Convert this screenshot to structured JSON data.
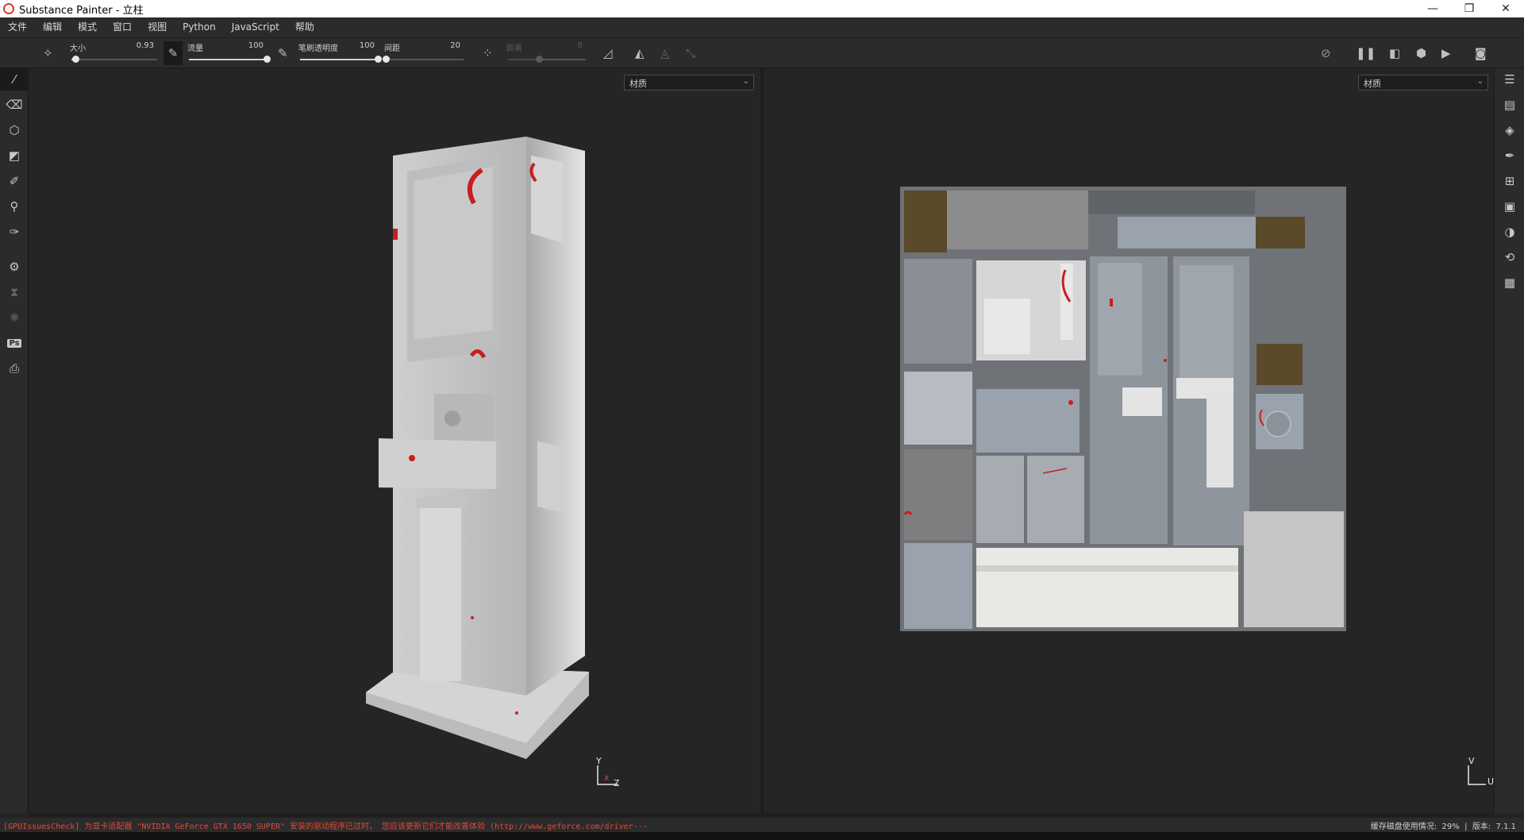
{
  "window": {
    "title": "Substance Painter - 立柱",
    "controls": [
      "—",
      "❐",
      "✕"
    ]
  },
  "menu": [
    "文件",
    "编辑",
    "模式",
    "窗口",
    "视图",
    "Python",
    "JavaScript",
    "帮助"
  ],
  "toolbar": {
    "size": {
      "label": "大小",
      "value": "0.93",
      "level": 0.05
    },
    "flow": {
      "label": "流量",
      "value": "100",
      "level": 1.0
    },
    "stroke_opacity": {
      "label": "笔刷透明度",
      "value": "100",
      "level": 1.0
    },
    "spacing": {
      "label": "间距",
      "value": "20",
      "level": 0.0
    },
    "jitter": {
      "label": "距离",
      "value": "8",
      "level": 0.4
    }
  },
  "viewports": {
    "left_select": "材质",
    "right_select": "材质",
    "axis_3d": {
      "y": "Y",
      "x": "X",
      "z": "Z"
    },
    "axis_2d": {
      "v": "V",
      "u": "U"
    }
  },
  "status": {
    "warning": "[GPUIssuesCheck] 为显卡适配器 \"NVIDIA GeForce GTX 1650 SUPER\" 安装的驱动程序已过时， 您应该更新它们才能改善体验 (http://www.geforce.com/driver···",
    "cache_label": "缓存磁盘使用情况:",
    "cache_value": "29%",
    "version_label": "版本:",
    "version_value": "7.1.1"
  },
  "icons": {
    "left_tools": [
      "brush-icon",
      "eraser-icon",
      "projection-icon",
      "polygon-fill-icon",
      "smudge-icon",
      "clone-icon",
      "color-picker-icon",
      "bake-icon",
      "hourglass-icon",
      "settings-icon",
      "photoshop-icon",
      "export-icon"
    ],
    "right_panels": [
      "layers-list-icon",
      "texture-set-icon",
      "layers-icon",
      "brush-settings-icon",
      "shelf-icon",
      "display-icon",
      "environment-icon",
      "history-icon",
      "log-icon"
    ]
  },
  "colors": {
    "accent_red": "#e24a3a",
    "background": "#252525",
    "panel": "#2b2b2b"
  }
}
